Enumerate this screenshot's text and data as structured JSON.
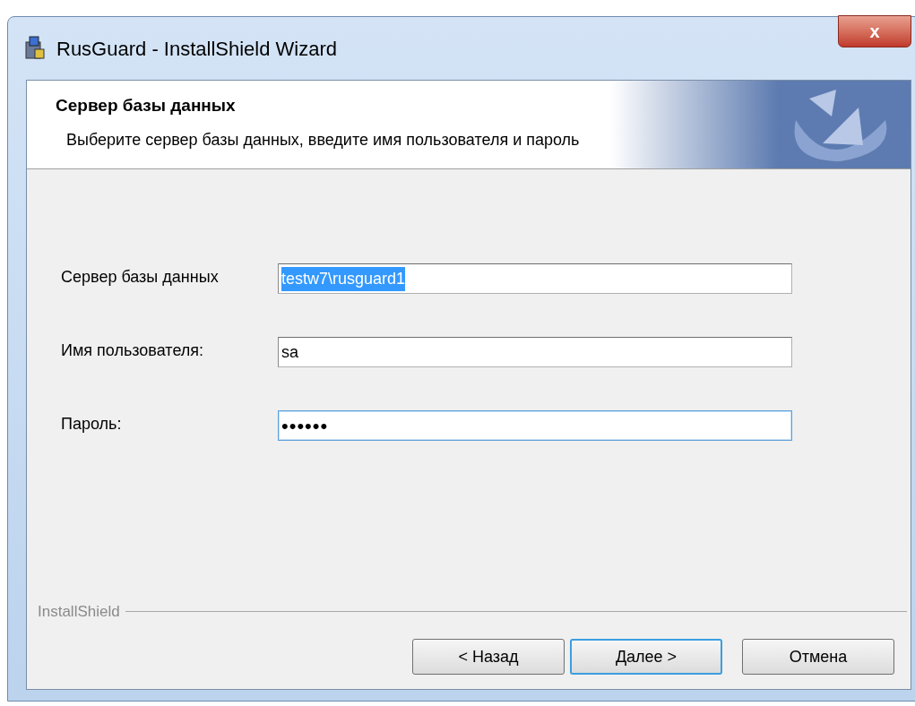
{
  "window": {
    "title": "RusGuard - InstallShield Wizard",
    "close": "x"
  },
  "header": {
    "title": "Сервер базы данных",
    "subtitle": "Выберите сервер базы данных, введите имя пользователя и пароль"
  },
  "fields": [
    {
      "label": "Сервер базы данных",
      "value": "testw7\\rusguard1",
      "kind": "text",
      "text_selected": true,
      "focused": false
    },
    {
      "label": "Имя пользователя:",
      "value": "sa",
      "kind": "text",
      "text_selected": false,
      "focused": false
    },
    {
      "label": "Пароль:",
      "value": "••••••",
      "kind": "password",
      "text_selected": false,
      "focused": true
    }
  ],
  "footer": {
    "brand": "InstallShield"
  },
  "buttons": [
    {
      "label": "< Назад",
      "default": false
    },
    {
      "label": "Далее >",
      "default": true
    },
    {
      "label": "Отмена",
      "default": false
    }
  ]
}
